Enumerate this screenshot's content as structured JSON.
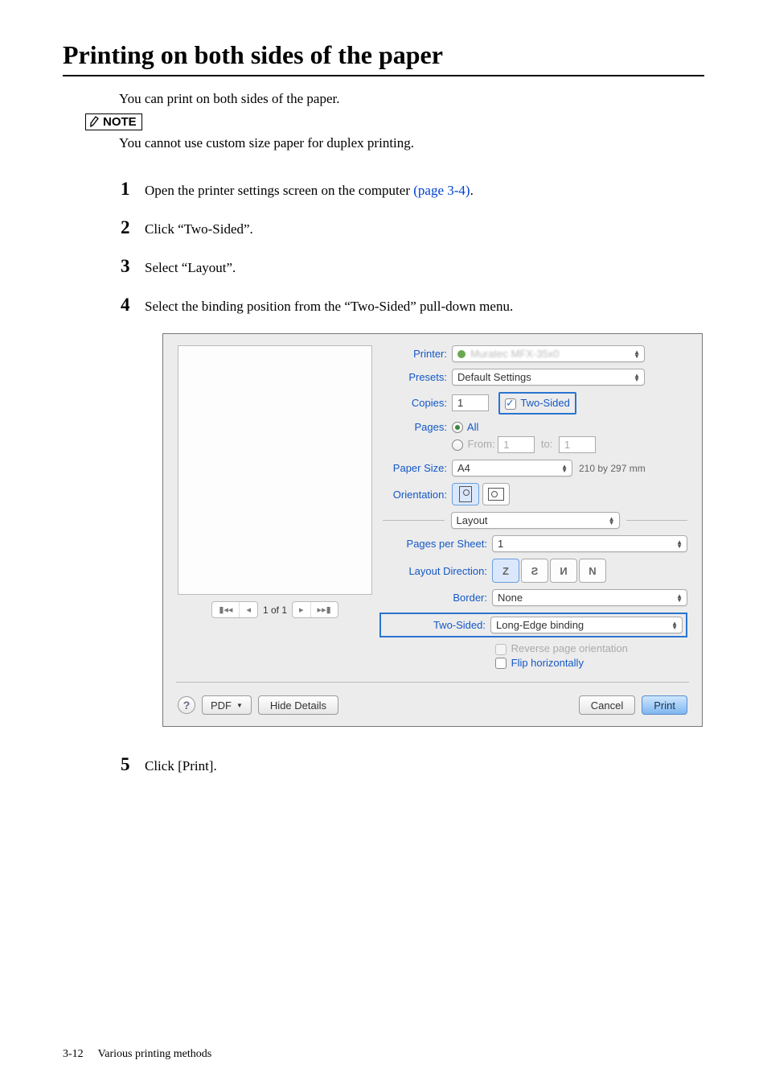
{
  "title": "Printing on both sides of the paper",
  "intro": "You can print on both sides of the paper.",
  "note_label": "NOTE",
  "note_text": "You cannot use custom size paper for duplex printing.",
  "steps": {
    "s1a": "Open the printer settings screen on the computer ",
    "s1link": "(page 3-4)",
    "s1b": ".",
    "s2": "Click “Two-Sided”.",
    "s3": "Select “Layout”.",
    "s4": "Select the binding position from the “Two-Sided” pull-down menu.",
    "s5": "Click [Print]."
  },
  "dialog": {
    "printer_label": "Printer:",
    "printer_value": "",
    "presets_label": "Presets:",
    "presets_value": "Default Settings",
    "copies_label": "Copies:",
    "copies_value": "1",
    "two_sided_chk": "Two-Sided",
    "pages_label": "Pages:",
    "pages_all": "All",
    "pages_from": "From:",
    "pages_from_v": "1",
    "pages_to": "to:",
    "pages_to_v": "1",
    "paper_size_label": "Paper Size:",
    "paper_size_value": "A4",
    "paper_dims": "210 by 297 mm",
    "orientation_label": "Orientation:",
    "section_select": "Layout",
    "pps_label": "Pages per Sheet:",
    "pps_value": "1",
    "layout_dir_label": "Layout Direction:",
    "border_label": "Border:",
    "border_value": "None",
    "twosided_label": "Two-Sided:",
    "twosided_value": "Long-Edge binding",
    "reverse_chk": "Reverse page orientation",
    "flip_chk": "Flip horizontally",
    "nav_pages": "1 of 1",
    "pdf_btn": "PDF",
    "hide_details": "Hide Details",
    "cancel": "Cancel",
    "print": "Print"
  },
  "footer": {
    "pageno": "3-12",
    "section": "Various printing methods"
  }
}
